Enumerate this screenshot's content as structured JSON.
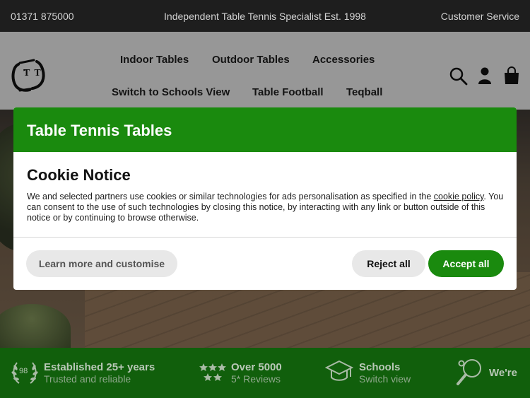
{
  "topbar": {
    "phone": "01371 875000",
    "tagline": "Independent Table Tennis Specialist Est. 1998",
    "customer_service": "Customer Service"
  },
  "logo": {
    "letters": "TT"
  },
  "nav": {
    "items": [
      {
        "label": "Indoor Tables"
      },
      {
        "label": "Outdoor Tables"
      },
      {
        "label": "Accessories"
      },
      {
        "label": "Switch to Schools View"
      },
      {
        "label": "Table Football"
      },
      {
        "label": "Teqball"
      }
    ]
  },
  "header_icons": [
    "search-icon",
    "account-icon",
    "basket-icon"
  ],
  "cookie_modal": {
    "header_title": "Table Tennis Tables",
    "title": "Cookie Notice",
    "body_before_link": "We and selected partners use cookies or similar technologies for ads personalisation as specified in the ",
    "link_text": "cookie policy",
    "body_after_link": ". You can consent to the use of such technologies by closing this notice, by interacting with any link or button outside of this notice or by continuing to browse otherwise.",
    "learn_more_label": "Learn more and customise",
    "reject_label": "Reject all",
    "accept_label": "Accept all"
  },
  "features": [
    {
      "icon": "laurel-98-icon",
      "badge": "98",
      "title": "Established 25+ years",
      "subtitle": "Trusted and reliable"
    },
    {
      "icon": "stars-icon",
      "title": "Over 5000",
      "subtitle": "5* Reviews"
    },
    {
      "icon": "graduation-cap-icon",
      "title": "Schools",
      "subtitle": "Switch view"
    },
    {
      "icon": "paddle-ball-icon",
      "title": "We're",
      "subtitle": ""
    }
  ],
  "colors": {
    "brand_green": "#1a8a0e",
    "features_green": "#115f0c",
    "topbar_bg": "#1e1e1e"
  }
}
